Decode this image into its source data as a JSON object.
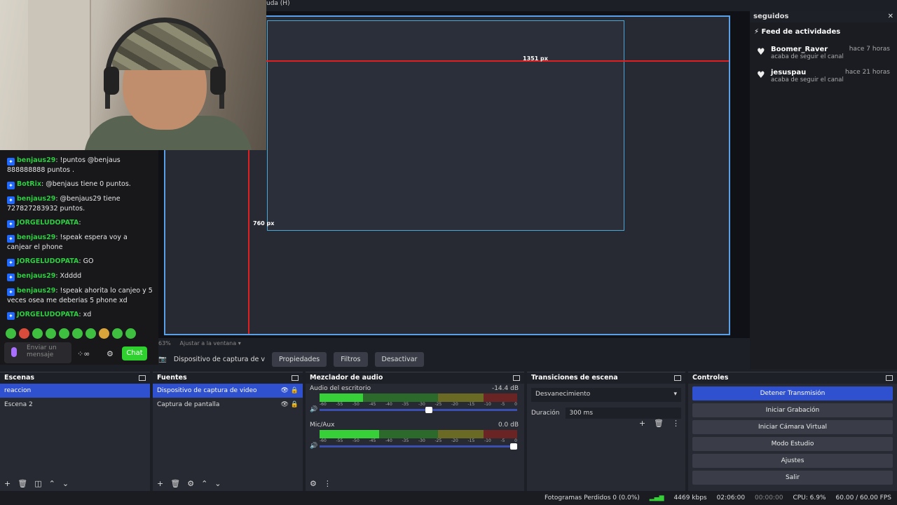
{
  "menu": {
    "help_fragment": "uda (H)"
  },
  "chat": {
    "messages": [
      {
        "user": "benjaus29",
        "text": ": !puntos @benjaus 888888888 puntos ."
      },
      {
        "user": "BotRix",
        "text": ": @benjaus tiene 0 puntos."
      },
      {
        "user": "benjaus29",
        "text": ": @benjaus29 tiene 727827283932 puntos."
      },
      {
        "user": "JORGELUDOPATA",
        "text": ":"
      },
      {
        "user": "benjaus29",
        "text": ": !speak espera voy a canjear el phone"
      },
      {
        "user": "JORGELUDOPATA",
        "text": ": GO"
      },
      {
        "user": "benjaus29",
        "text": ": Xdddd"
      },
      {
        "user": "benjaus29",
        "text": ": !speak ahorita lo canjeo y 5 veces osea me deberias 5 phone xd"
      },
      {
        "user": "JORGELUDOPATA",
        "text": ": xd"
      }
    ],
    "input_placeholder": "Enviar un mensaje",
    "send_label": "Chat"
  },
  "preview": {
    "dim_width": "1351 px",
    "dim_height": "760 px"
  },
  "feed": {
    "header": "seguidos",
    "title": "Feed de actividades",
    "items": [
      {
        "name": "Boomer_Raver",
        "time": "hace 7 horas",
        "desc": "acaba de seguir el canal"
      },
      {
        "name": "jesuspau",
        "time": "hace 21 horas",
        "desc": "acaba de seguir el canal"
      }
    ]
  },
  "zoombar": {
    "zoom": "63%",
    "fit": "Ajustar a la ventana"
  },
  "sourcebar": {
    "source": "Dispositivo de captura de v",
    "props": "Propiedades",
    "filters": "Filtros",
    "deactivate": "Desactivar"
  },
  "scenes": {
    "title": "Escenas",
    "items": [
      "reaccion",
      "Escena 2"
    ]
  },
  "sources": {
    "title": "Fuentes",
    "items": [
      "Dispositivo de captura de video",
      "Captura de pantalla"
    ]
  },
  "mixer": {
    "title": "Mezclador de audio",
    "channels": [
      {
        "name": "Audio del escritorio",
        "db": "-14.4 dB",
        "level": 0.22,
        "volume": 0.57
      },
      {
        "name": "Mic/Aux",
        "db": "0.0 dB",
        "level": 0.3,
        "volume": 1.0
      }
    ],
    "ticks": [
      "-60",
      "-55",
      "-50",
      "-45",
      "-40",
      "-35",
      "-30",
      "-25",
      "-20",
      "-15",
      "-10",
      "-5",
      "0"
    ]
  },
  "transitions": {
    "title": "Transiciones de escena",
    "selected": "Desvanecimiento",
    "duration_label": "Duración",
    "duration_value": "300 ms"
  },
  "controls": {
    "title": "Controles",
    "buttons": [
      "Detener Transmisión",
      "Iniciar Grabación",
      "Iniciar Cámara Virtual",
      "Modo Estudio",
      "Ajustes",
      "Salir"
    ]
  },
  "status": {
    "dropped": "Fotogramas Perdidos 0 (0.0%)",
    "bitrate": "4469 kbps",
    "live_time": "02:06:00",
    "rec_time": "00:00:00",
    "cpu": "CPU: 6.9%",
    "fps": "60.00 / 60.00 FPS"
  },
  "colors": {
    "accent": "#2f51d0",
    "chat_user": "#2ecc40",
    "chat_button": "#2ed12e"
  }
}
